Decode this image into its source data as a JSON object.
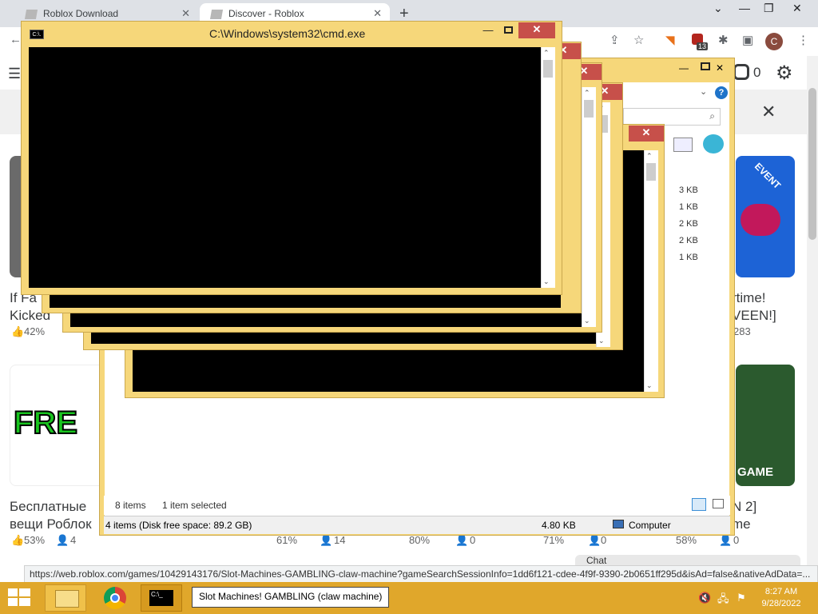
{
  "browser": {
    "tabs": [
      {
        "title": "Roblox Download",
        "active": false
      },
      {
        "title": "Discover - Roblox",
        "active": true
      }
    ],
    "new_tab_symbol": "+",
    "window_controls": {
      "minimize": "⌄",
      "restore": "—",
      "max": "❐",
      "close": "✕"
    },
    "extension_badge": "13",
    "profile_initial": "C",
    "menu_symbol": "⋮"
  },
  "roblox": {
    "robux_count": "0",
    "close_symbol": "✕",
    "cards_row1": [
      {
        "title_l1": "If Fa",
        "title_l2": "Kicked",
        "like": "42%"
      },
      {
        "title_l1": "rtime!",
        "title_l2": "VEEN!]",
        "stat": "283",
        "badge": "EVENT"
      }
    ],
    "cards_row2": [
      {
        "title_l1": "Бесплатные",
        "title_l2": "вещи Роблок",
        "like": "53%",
        "players": "4",
        "img_text": "FRE"
      },
      {
        "title_l1": "N 2]",
        "title_l2": "me",
        "img_text": "GAME"
      }
    ],
    "row2_stats": [
      {
        "like": "61%",
        "players": "14"
      },
      {
        "like": "80%",
        "players": "0"
      },
      {
        "like": "71%",
        "players": "0"
      },
      {
        "like": "58%",
        "players": "0"
      }
    ],
    "chat_label": "Chat"
  },
  "explorer": {
    "sizes": [
      "3 KB",
      "1 KB",
      "2 KB",
      "2 KB",
      "1 KB"
    ],
    "items_count": "8 items",
    "selected": "1 item selected",
    "status_left": "4 items (Disk free space: 89.2 GB)",
    "status_size": "4.80 KB",
    "status_location": "Computer",
    "help_symbol": "?"
  },
  "cmd": {
    "title": "C:\\Windows\\system32\\cmd.exe",
    "icon_text": "C:\\."
  },
  "status_url": "https://web.roblox.com/games/10429143176/Slot-Machines-GAMBLING-claw-machine?gameSearchSessionInfo=1dd6f121-cdee-4f9f-9390-2b0651ff295d&isAd=false&nativeAdData=...",
  "taskbar": {
    "tooltip": "Slot Machines! GAMBLING (claw machine)",
    "time": "8:27 AM",
    "date": "9/28/2022",
    "cmd_icon_text": "C:\\_"
  },
  "colors": {
    "window_frame": "#f6d77a",
    "close_red": "#c7504a",
    "taskbar": "#e0a72b"
  }
}
